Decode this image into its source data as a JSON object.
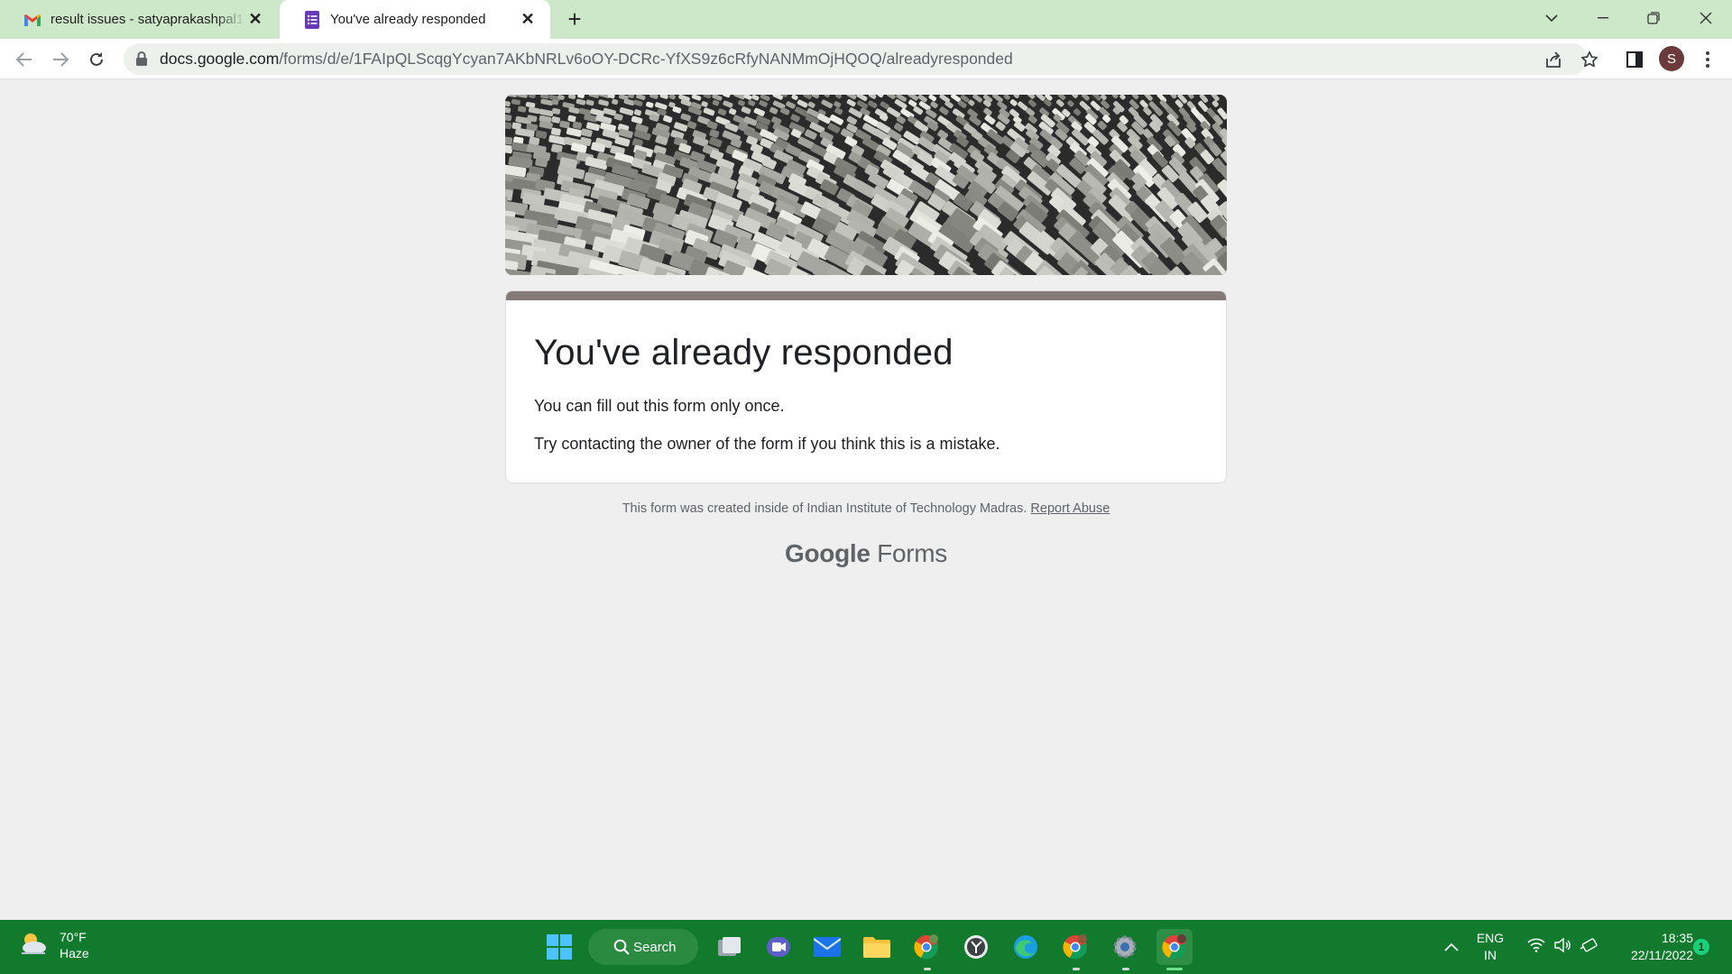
{
  "browser": {
    "tabs": [
      {
        "title": "result issues - satyaprakashpal1507",
        "favicon": "gmail-icon",
        "active": false
      },
      {
        "title": "You've already responded",
        "favicon": "google-forms-icon",
        "active": true
      }
    ],
    "url": {
      "host": "docs.google.com",
      "path": "/forms/d/e/1FAIpQLScqgYcyan7AKbNRLv6oOY-DCRc-YfXS9z6cRfyNANMmOjHQOQ/alreadyresponded"
    },
    "profile_initial": "S"
  },
  "form": {
    "heading": "You've already responded",
    "message_1": "You can fill out this form only once.",
    "message_2": "Try contacting the owner of the form if you think this is a mistake.",
    "footer_text": "This form was created inside of Indian Institute of Technology Madras.",
    "report_link": "Report Abuse",
    "brand_google": "Google",
    "brand_forms": "Forms",
    "header_accent_color": "#857a7a"
  },
  "taskbar": {
    "weather_temp": "70°F",
    "weather_desc": "Haze",
    "search_label": "Search",
    "language_top": "ENG",
    "language_bottom": "IN",
    "time": "18:35",
    "date": "22/11/2022",
    "notification_count": "1"
  }
}
